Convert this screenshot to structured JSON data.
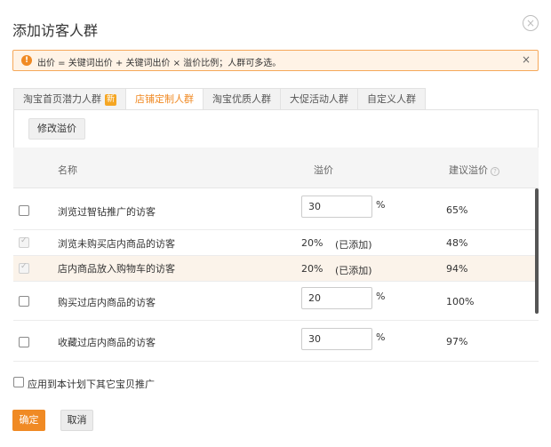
{
  "dialog": {
    "title": "添加访客人群",
    "close_icon": "×"
  },
  "alert": {
    "icon": "!",
    "text": "出价 = 关键词出价 + 关键词出价 × 溢价比例；人群可多选。",
    "close_icon": "×"
  },
  "tabs": [
    {
      "label": "淘宝首页潜力人群",
      "badge": "新",
      "active": false
    },
    {
      "label": "店铺定制人群",
      "active": true
    },
    {
      "label": "淘宝优质人群",
      "active": false
    },
    {
      "label": "大促活动人群",
      "active": false
    },
    {
      "label": "自定义人群",
      "active": false
    }
  ],
  "toolbar": {
    "modify_label": "修改溢价"
  },
  "table": {
    "headers": {
      "name": "名称",
      "premium": "溢价",
      "suggest": "建议溢价",
      "help_icon": "?"
    },
    "rows": [
      {
        "name": "浏览过智钻推广的访客",
        "premium_value": "30",
        "unit": "%",
        "suggest": "65%",
        "state": "editable"
      },
      {
        "name": "浏览未购买店内商品的访客",
        "premium_text": "20%",
        "added_text": "(已添加)",
        "suggest": "48%",
        "state": "added"
      },
      {
        "name": "店内商品放入购物车的访客",
        "premium_text": "20%",
        "added_text": "(已添加)",
        "suggest": "94%",
        "state": "added"
      },
      {
        "name": "购买过店内商品的访客",
        "premium_value": "20",
        "unit": "%",
        "suggest": "100%",
        "state": "editable"
      },
      {
        "name": "收藏过店内商品的访客",
        "premium_value": "30",
        "unit": "%",
        "suggest": "97%",
        "state": "editable"
      }
    ]
  },
  "footer": {
    "apply_label": "应用到本计划下其它宝贝推广",
    "confirm_label": "确定",
    "cancel_label": "取消"
  },
  "colors": {
    "accent": "#f08a24",
    "alert_bg": "#fff3e6",
    "alert_border": "#f6a85a",
    "highlight_row": "#fbf3ea"
  }
}
